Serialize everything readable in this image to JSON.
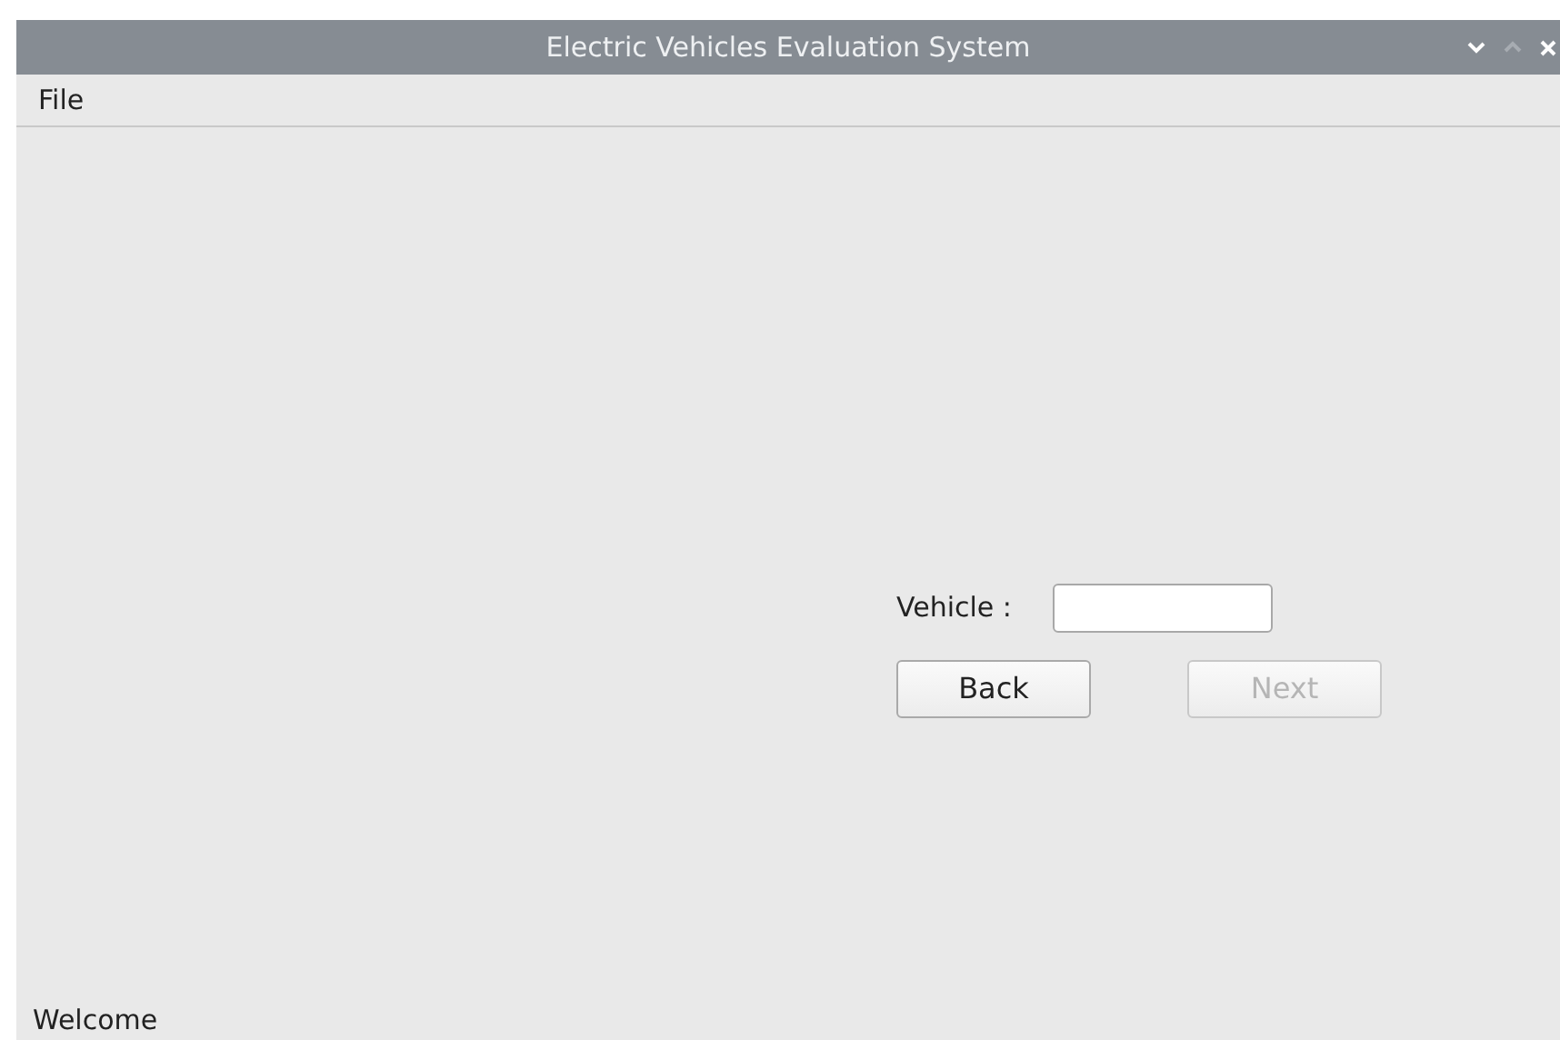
{
  "window": {
    "title": "Electric Vehicles Evaluation System"
  },
  "menu": [
    {
      "label": "File"
    }
  ],
  "form": {
    "vehicle_label": "Vehicle :"
  },
  "buttons": [
    {
      "label": "Back",
      "disabled": false
    },
    {
      "label": "Next",
      "disabled": true
    }
  ],
  "status_bar": "Welcome"
}
